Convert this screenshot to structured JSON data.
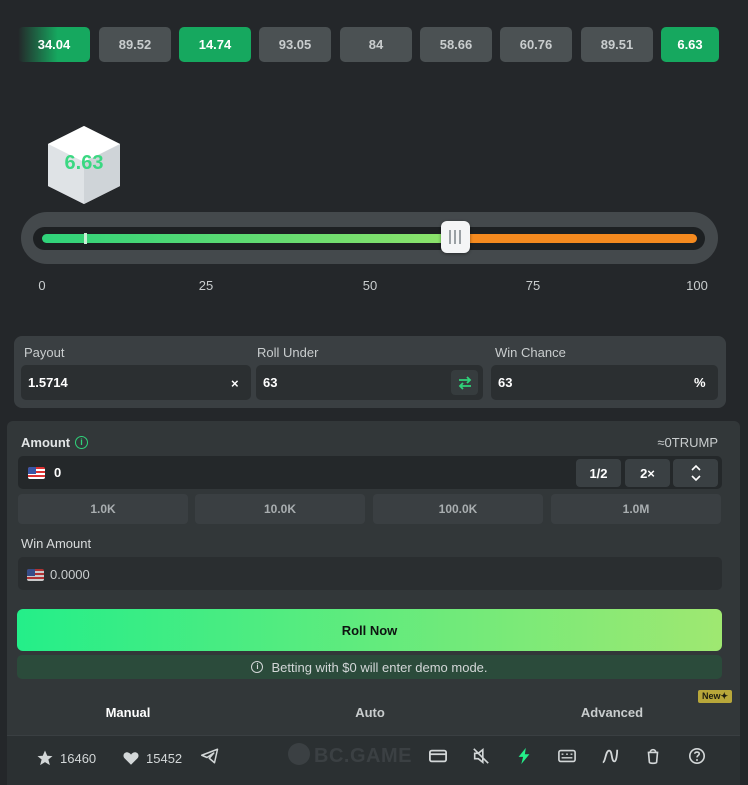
{
  "history": [
    {
      "value": "34.04",
      "state": "win-fade"
    },
    {
      "value": "89.52",
      "state": "loss"
    },
    {
      "value": "14.74",
      "state": "win"
    },
    {
      "value": "93.05",
      "state": "loss"
    },
    {
      "value": "84",
      "state": "loss"
    },
    {
      "value": "58.66",
      "state": "loss"
    },
    {
      "value": "60.76",
      "state": "loss"
    },
    {
      "value": "89.51",
      "state": "loss"
    },
    {
      "value": "6.63",
      "state": "win"
    }
  ],
  "dice": {
    "result": "6.63"
  },
  "slider": {
    "ticks": [
      "0",
      "25",
      "50",
      "75",
      "100"
    ],
    "roll_under": 63,
    "last_result": 6.63,
    "min": 0,
    "max": 100,
    "colors": {
      "win": "#2fd37a",
      "lose": "#f58a1f"
    }
  },
  "params": {
    "payout_label": "Payout",
    "payout_value": "1.5714",
    "payout_suffix": "×",
    "roll_under_label": "Roll Under",
    "roll_under_value": "63",
    "win_chance_label": "Win Chance",
    "win_chance_value": "63",
    "win_chance_suffix": "%"
  },
  "bet": {
    "amount_label": "Amount",
    "currency_estimate": "≈0TRUMP",
    "amount_value": "0",
    "half_label": "1/2",
    "double_label": "2×",
    "quick_amounts": [
      "1.0K",
      "10.0K",
      "100.0K",
      "1.0M"
    ],
    "win_amount_label": "Win Amount",
    "win_amount_value": "0.0000",
    "roll_button": "Roll Now",
    "demo_notice": "Betting with $0 will enter demo mode.",
    "info_glyph": "i"
  },
  "modes": {
    "tabs": [
      "Manual",
      "Auto",
      "Advanced"
    ],
    "active": "Manual",
    "new_badge": "New✦"
  },
  "footer": {
    "favorites": "16460",
    "likes": "15452",
    "brand": "BC.GAME",
    "icons": [
      "star-icon",
      "heart-icon",
      "telegram-icon",
      "card-icon",
      "sound-off-icon",
      "lightning-icon",
      "keyboard-icon",
      "chart-icon",
      "fairness-icon",
      "help-icon"
    ]
  },
  "accent": "#24ee89"
}
